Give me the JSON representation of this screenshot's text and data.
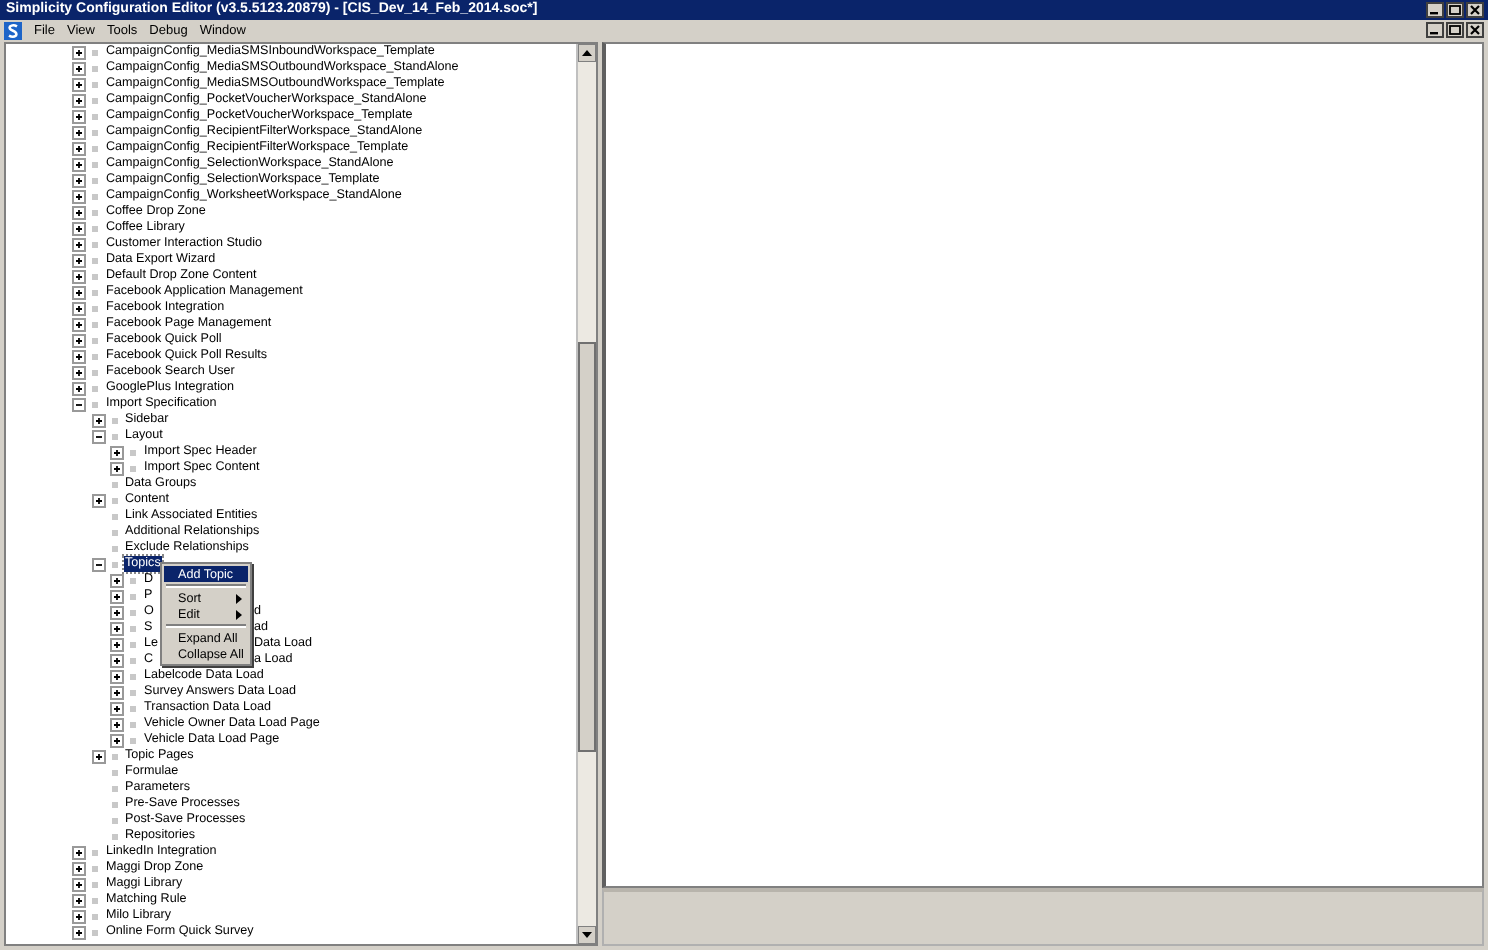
{
  "window": {
    "title": "Simplicity Configuration Editor (v3.5.5123.20879) - [CIS_Dev_14_Feb_2014.soc*]"
  },
  "menu_bar": [
    {
      "label": "File"
    },
    {
      "label": "View"
    },
    {
      "label": "Tools"
    },
    {
      "label": "Debug"
    },
    {
      "label": "Window"
    }
  ],
  "tree": [
    {
      "label": "CampaignConfig_MediaSMSInboundWorkspace_Template",
      "expanded": false,
      "selected": false
    },
    {
      "label": "CampaignConfig_MediaSMSOutboundWorkspace_StandAlone",
      "expanded": false,
      "selected": false
    },
    {
      "label": "CampaignConfig_MediaSMSOutboundWorkspace_Template",
      "expanded": false,
      "selected": false
    },
    {
      "label": "CampaignConfig_PocketVoucherWorkspace_StandAlone",
      "expanded": false,
      "selected": false
    },
    {
      "label": "CampaignConfig_PocketVoucherWorkspace_Template",
      "expanded": false,
      "selected": false
    },
    {
      "label": "CampaignConfig_RecipientFilterWorkspace_StandAlone",
      "expanded": false,
      "selected": false
    },
    {
      "label": "CampaignConfig_RecipientFilterWorkspace_Template",
      "expanded": false,
      "selected": false
    },
    {
      "label": "CampaignConfig_SelectionWorkspace_StandAlone",
      "expanded": false,
      "selected": false
    },
    {
      "label": "CampaignConfig_SelectionWorkspace_Template",
      "expanded": false,
      "selected": false
    },
    {
      "label": "CampaignConfig_WorksheetWorkspace_StandAlone",
      "expanded": false,
      "selected": false
    },
    {
      "label": "Coffee Drop Zone",
      "expanded": false,
      "selected": false
    },
    {
      "label": "Coffee Library",
      "expanded": false,
      "selected": false
    },
    {
      "label": "Customer Interaction Studio",
      "expanded": false,
      "selected": false
    },
    {
      "label": "Data Export Wizard",
      "expanded": false,
      "selected": false
    },
    {
      "label": "Default Drop Zone Content",
      "expanded": false,
      "selected": false
    },
    {
      "label": "Facebook Application Management",
      "expanded": false,
      "selected": false
    },
    {
      "label": "Facebook Integration",
      "expanded": false,
      "selected": false
    },
    {
      "label": "Facebook Page Management",
      "expanded": false,
      "selected": false
    },
    {
      "label": "Facebook Quick Poll",
      "expanded": false,
      "selected": false
    },
    {
      "label": "Facebook Quick Poll Results",
      "expanded": false,
      "selected": false
    },
    {
      "label": "Facebook Search User",
      "expanded": false,
      "selected": false
    },
    {
      "label": "GooglePlus Integration",
      "expanded": false,
      "selected": false
    },
    {
      "label": "Import Specification",
      "expanded": true,
      "selected": false,
      "children": [
        {
          "label": "Sidebar",
          "expanded": false,
          "selected": false
        },
        {
          "label": "Layout",
          "expanded": true,
          "selected": false,
          "children": [
            {
              "label": "Import Spec Header",
              "expanded": false,
              "selected": false
            },
            {
              "label": "Import Spec Content",
              "expanded": false,
              "selected": false
            }
          ]
        },
        {
          "label": "Data Groups",
          "selected": false
        },
        {
          "label": "Content",
          "expanded": false,
          "selected": false
        },
        {
          "label": "Link Associated Entities",
          "selected": false
        },
        {
          "label": "Additional Relationships",
          "selected": false
        },
        {
          "label": "Exclude Relationships",
          "selected": false
        },
        {
          "label": "Topics",
          "expanded": true,
          "selected": true,
          "children": [
            {
              "label": "D",
              "expanded": false,
              "selected": false
            },
            {
              "label": "P",
              "expanded": false,
              "selected": false
            },
            {
              "label": "O",
              "tail": "d",
              "expanded": false,
              "selected": false
            },
            {
              "label": "S",
              "tail": "ad",
              "expanded": false,
              "selected": false
            },
            {
              "label": "Le",
              "tail": "Data Load",
              "expanded": false,
              "selected": false
            },
            {
              "label": "C",
              "tail": "a Load",
              "expanded": false,
              "selected": false
            },
            {
              "label": "Labelcode Data Load",
              "expanded": false,
              "selected": false
            },
            {
              "label": "Survey Answers Data Load",
              "expanded": false,
              "selected": false
            },
            {
              "label": "Transaction Data Load",
              "expanded": false,
              "selected": false
            },
            {
              "label": "Vehicle Owner Data Load Page",
              "expanded": false,
              "selected": false
            },
            {
              "label": "Vehicle Data Load Page",
              "expanded": false,
              "selected": false
            }
          ]
        },
        {
          "label": "Topic Pages",
          "expanded": false,
          "selected": false
        },
        {
          "label": "Formulae",
          "selected": false
        },
        {
          "label": "Parameters",
          "selected": false
        },
        {
          "label": "Pre-Save Processes",
          "selected": false
        },
        {
          "label": "Post-Save Processes",
          "selected": false
        },
        {
          "label": "Repositories",
          "selected": false
        }
      ]
    },
    {
      "label": "LinkedIn Integration",
      "expanded": false,
      "selected": false
    },
    {
      "label": "Maggi Drop Zone",
      "expanded": false,
      "selected": false
    },
    {
      "label": "Maggi Library",
      "expanded": false,
      "selected": false
    },
    {
      "label": "Matching Rule",
      "expanded": false,
      "selected": false
    },
    {
      "label": "Milo Library",
      "expanded": false,
      "selected": false
    },
    {
      "label": "Online Form Quick Survey",
      "expanded": false,
      "selected": false
    }
  ],
  "context_menu": [
    {
      "kind": "item",
      "label": "Add Topic",
      "selected": true
    },
    {
      "kind": "separator"
    },
    {
      "kind": "submenu",
      "label": "Sort",
      "selected": false
    },
    {
      "kind": "submenu",
      "label": "Edit",
      "selected": false
    },
    {
      "kind": "separator"
    },
    {
      "kind": "item",
      "label": "Expand All",
      "selected": false
    },
    {
      "kind": "item",
      "label": "Collapse All",
      "selected": false
    }
  ]
}
